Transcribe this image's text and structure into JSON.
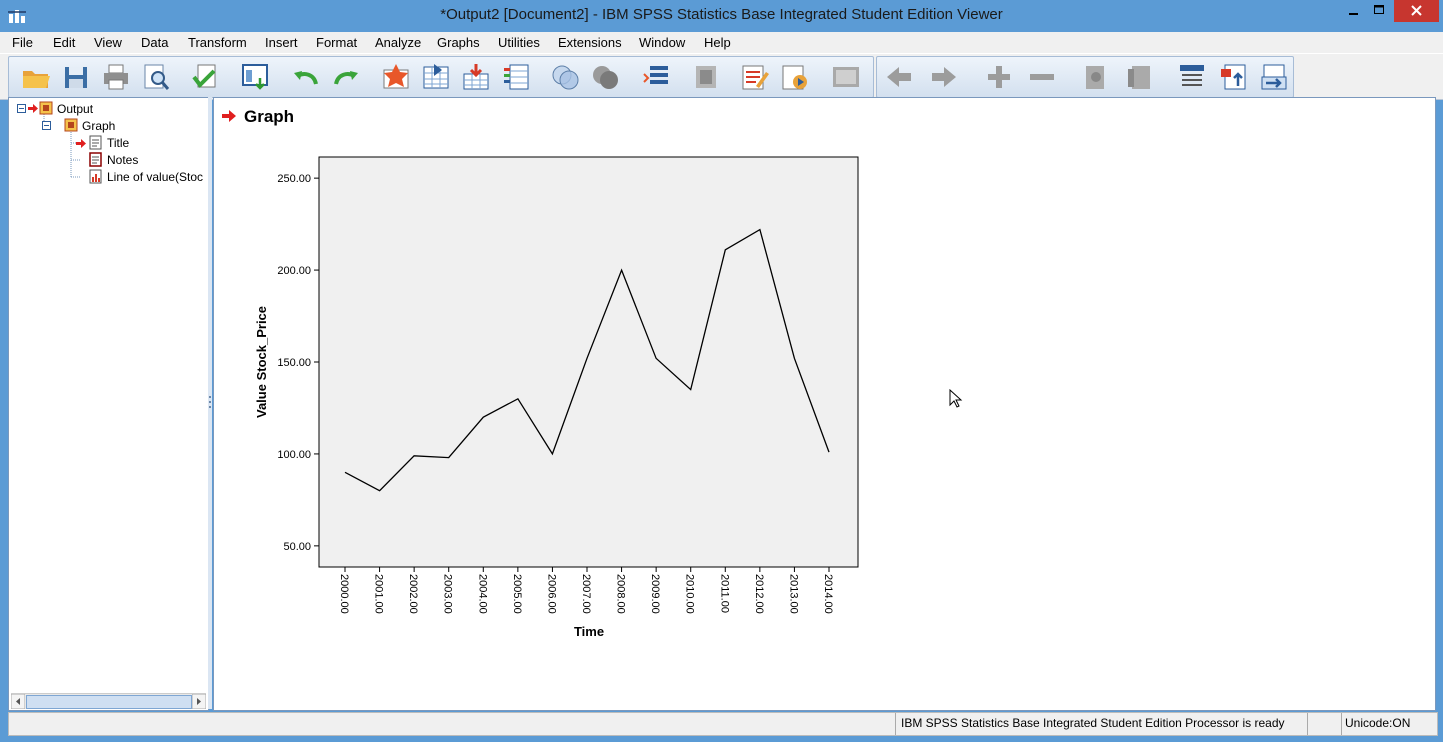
{
  "window": {
    "title": "*Output2 [Document2] - IBM SPSS Statistics Base Integrated Student Edition Viewer"
  },
  "menu": [
    "File",
    "Edit",
    "View",
    "Data",
    "Transform",
    "Insert",
    "Format",
    "Analyze",
    "Graphs",
    "Utilities",
    "Extensions",
    "Window",
    "Help"
  ],
  "toolbar_icons": [
    "open-icon",
    "save-icon",
    "print-icon",
    "print-preview-icon",
    "export-icon",
    "recall-dialog-icon",
    "undo-icon",
    "redo-icon",
    "goto-data-icon",
    "goto-case-icon",
    "goto-variable-icon",
    "variables-icon",
    "use-sets-icon",
    "show-all-variables-icon",
    "spell-check-icon",
    "designate-window-icon",
    "insert-heading-icon",
    "insert-title-icon",
    "insert-text-icon",
    "create-chart-icon",
    "promote-icon",
    "demote-icon",
    "expand-icon",
    "collapse-icon",
    "show-icon",
    "hide-icon",
    "insert-header-icon",
    "insert-output-icon",
    "move-icon"
  ],
  "outline": {
    "root": "Output",
    "graph": "Graph",
    "title": "Title",
    "notes": "Notes",
    "line": "Line of value(Stoc"
  },
  "content": {
    "heading": "Graph"
  },
  "chart_data": {
    "type": "line",
    "xlabel": "Time",
    "ylabel": "Value Stock_Price",
    "x": [
      "2000.00",
      "2001.00",
      "2002.00",
      "2003.00",
      "2004.00",
      "2005.00",
      "2006.00",
      "2007.00",
      "2008.00",
      "2009.00",
      "2010.00",
      "2011.00",
      "2012.00",
      "2013.00",
      "2014.00"
    ],
    "values": [
      90,
      80,
      99,
      98,
      120,
      130,
      100,
      152,
      200,
      152,
      135,
      211,
      222,
      152,
      101
    ],
    "ylim": [
      38.5,
      261.5
    ],
    "yticks": [
      "50.00",
      "100.00",
      "150.00",
      "200.00",
      "250.00"
    ],
    "grid": false,
    "colors": {
      "line": "#000000",
      "plot_bg": "#f0f0f0"
    }
  },
  "status": {
    "message": "IBM SPSS Statistics Base Integrated Student Edition Processor is ready",
    "unicode": "Unicode:ON"
  }
}
